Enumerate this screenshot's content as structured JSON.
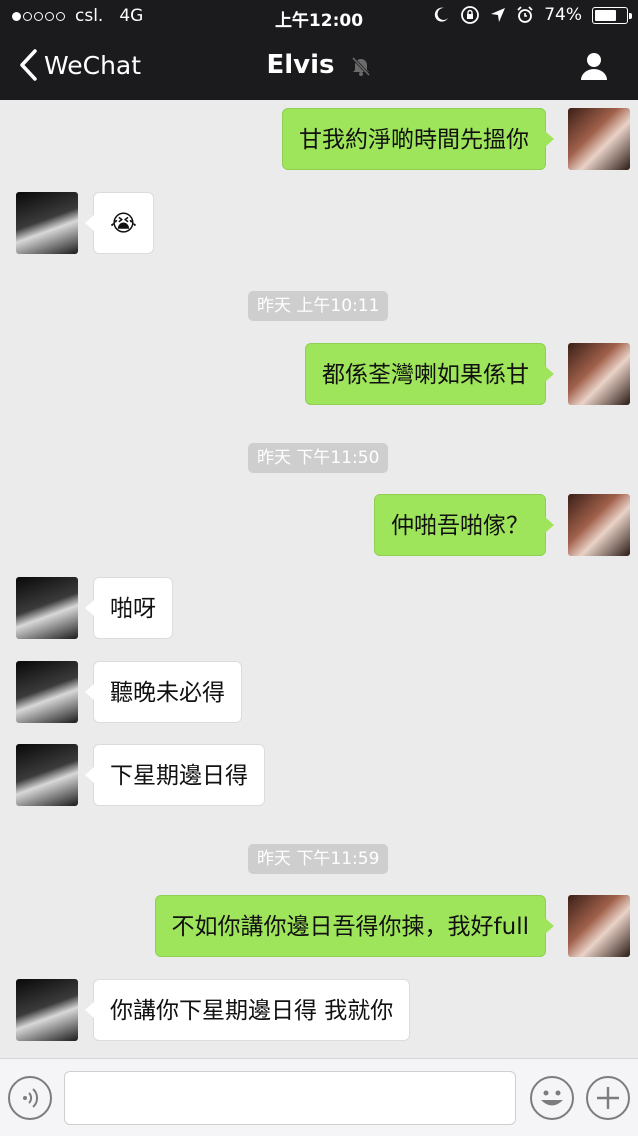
{
  "status_bar": {
    "carrier": "csl.",
    "network": "4G",
    "time": "上午12:00",
    "battery": "74%",
    "battery_level": 0.74,
    "signal_full_dots": 1,
    "signal_total_dots": 5
  },
  "nav": {
    "back_label": "WeChat",
    "title": "Elvis",
    "icons": [
      "back-chevron-icon",
      "mute-bell-icon",
      "profile-person-icon"
    ]
  },
  "messages": [
    {
      "type": "out",
      "text": "甘我約淨啲時間先搵你"
    },
    {
      "type": "in",
      "text": "😭"
    },
    {
      "type": "timestamp",
      "text": "昨天 上午10:11"
    },
    {
      "type": "out",
      "text": "都係荃灣喇如果係甘"
    },
    {
      "type": "timestamp",
      "text": "昨天 下午11:50"
    },
    {
      "type": "out",
      "text": "仲啪吾啪傢？"
    },
    {
      "type": "in",
      "text": "啪呀"
    },
    {
      "type": "in",
      "text": "聽晚未必得"
    },
    {
      "type": "in",
      "text": "下星期邊日得"
    },
    {
      "type": "timestamp",
      "text": "昨天 下午11:59"
    },
    {
      "type": "out",
      "text": "不如你講你邊日吾得你揀，我好full"
    },
    {
      "type": "in",
      "text": "你講你下星期邊日得 我就你"
    }
  ],
  "input_bar": {
    "value": "",
    "icons": [
      "voice-icon",
      "emoji-icon",
      "plus-icon"
    ]
  },
  "colors": {
    "nav_bg": "#1b1b1e",
    "chat_bg": "#ebebeb",
    "outgoing_bubble": "#9fe55b",
    "incoming_bubble": "#ffffff",
    "timestamp_bg": "#cecece"
  }
}
